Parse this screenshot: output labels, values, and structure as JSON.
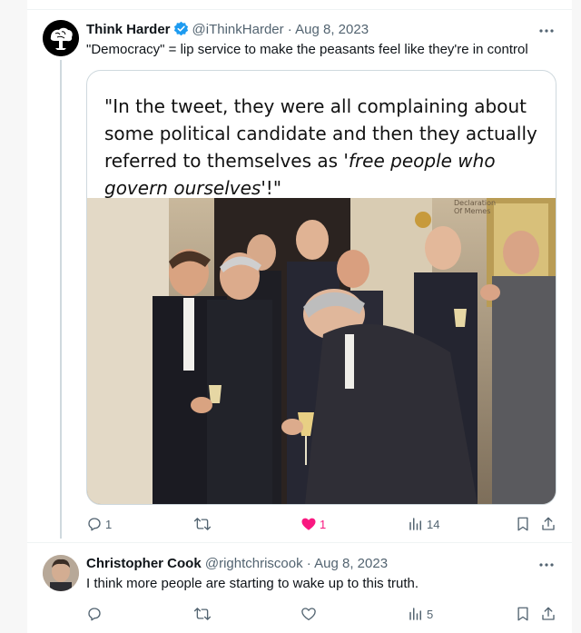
{
  "tweet": {
    "author_name": "Think Harder",
    "handle": "@iThinkHarder",
    "dot": "·",
    "date": "Aug 8, 2023",
    "text": "\"Democracy\" = lip service to make the peasants feel like they're in control",
    "media": {
      "quote_part1": "\"In the tweet, they were all complaining about some political candidate and then they actually referred to themselves as '",
      "quote_italic": "free people who govern ourselves",
      "quote_part2": "'!\"",
      "watermark_line1": "Declaration",
      "watermark_line2": "Of Memes"
    },
    "actions": {
      "replies": "1",
      "retweets": "",
      "likes": "1",
      "views": "14"
    },
    "like_color": "#f91880"
  },
  "reply": {
    "author_name": "Christopher Cook",
    "handle": "@rightchriscook",
    "dot": "·",
    "date": "Aug 8, 2023",
    "text": "I think more people are starting to wake up to this truth.",
    "actions": {
      "replies": "",
      "retweets": "",
      "likes": "",
      "views": "5"
    }
  },
  "colors": {
    "accent": "#1d9bf0",
    "muted": "#536471"
  }
}
